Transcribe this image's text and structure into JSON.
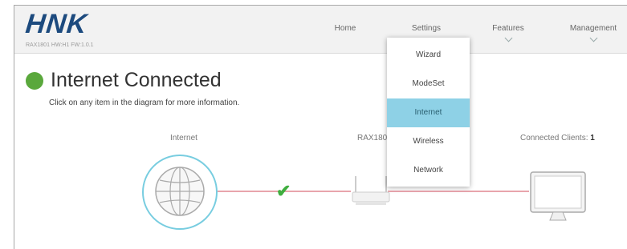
{
  "brand": {
    "logo": "HNK",
    "firmware": "RAX1801 HW:H1 FW:1.0.1"
  },
  "nav": [
    {
      "label": "Home",
      "chevron": false
    },
    {
      "label": "Settings",
      "chevron": false
    },
    {
      "label": "Features",
      "chevron": true
    },
    {
      "label": "Management",
      "chevron": true
    }
  ],
  "status": {
    "text": "Internet Connected",
    "color": "#5aa83c"
  },
  "hint": "Click on any item in the diagram for more information.",
  "diagram": {
    "internet_label": "Internet",
    "router_label": "RAX1801",
    "clients_label": "Connected Clients:",
    "clients_count": "1",
    "link_color": "#e8a5ac",
    "ring_color": "#78cde0"
  },
  "settings_menu": {
    "items": [
      "Wizard",
      "ModeSet",
      "Internet",
      "Wireless",
      "Network"
    ],
    "active": "Internet",
    "active_color": "#8ed1e6"
  }
}
